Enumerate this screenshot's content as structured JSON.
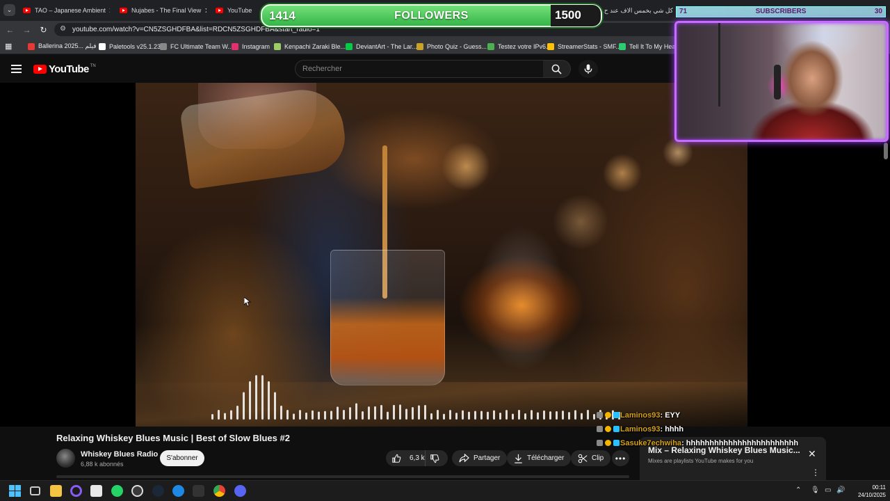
{
  "tabs": [
    {
      "label": "TAO – Japanese Ambient"
    },
    {
      "label": "Nujabes - The Final View"
    },
    {
      "label": "YouTube"
    },
    {
      "label": "كل شي بخمس الاف عند ح..."
    }
  ],
  "address": {
    "url": "youtube.com/watch?v=CN5ZSGHDFBA&list=RDCN5ZSGHDFBA&start_radio=1"
  },
  "bookmarks": [
    {
      "label": "Ballerina 2025... فيلم",
      "color": "#e53935"
    },
    {
      "label": "Paletools v25.1.23",
      "color": "#ffffff"
    },
    {
      "label": "FC Ultimate Team W...",
      "color": "#888888"
    },
    {
      "label": "Instagram",
      "color": "#e1306c"
    },
    {
      "label": "Kenpachi Zaraki Ble...",
      "color": "#9ccc65"
    },
    {
      "label": "DeviantArt - The Lar...",
      "color": "#05cc47"
    },
    {
      "label": "Photo Quiz - Guess...",
      "color": "#c9a227"
    },
    {
      "label": "Testez votre IPv6.",
      "color": "#4caf50"
    },
    {
      "label": "StreamerStats - SMF...",
      "color": "#ffc107"
    },
    {
      "label": "Tell It To My Heart",
      "color": "#2ecc71"
    }
  ],
  "youtube": {
    "logo_text": "YouTube",
    "logo_tm": "TN",
    "search_placeholder": "Rechercher"
  },
  "video": {
    "title": "Relaxing Whiskey Blues Music | Best of Slow Blues #2",
    "channel": "Whiskey Blues Radio",
    "subscribers": "6,88 k abonnés",
    "subscribe_label": "S'abonner",
    "likes": "6,3 k",
    "share_label": "Partager",
    "download_label": "Télécharger",
    "clip_label": "Clip"
  },
  "mix": {
    "title": "Mix – Relaxing Whiskey Blues Music...",
    "subtitle": "Mixes are playlists YouTube makes for you"
  },
  "overlay": {
    "followers_current": "1414",
    "followers_label": "FOLLOWERS",
    "followers_goal": "1500",
    "subscribers_current": "71",
    "subscribers_label": "SUBSCRIBERS",
    "subscribers_goal": "30",
    "accent": "#c86cff"
  },
  "chat": [
    {
      "user": "Laminos93",
      "message": ": EYY"
    },
    {
      "user": "Laminos93",
      "message": ": hhhh"
    },
    {
      "user": "Sasuke7echwiha",
      "message": ": hhhhhhhhhhhhhhhhhhhhhhhh"
    }
  ],
  "taskbar": {
    "time": "00:11",
    "date": "24/10/2025"
  }
}
